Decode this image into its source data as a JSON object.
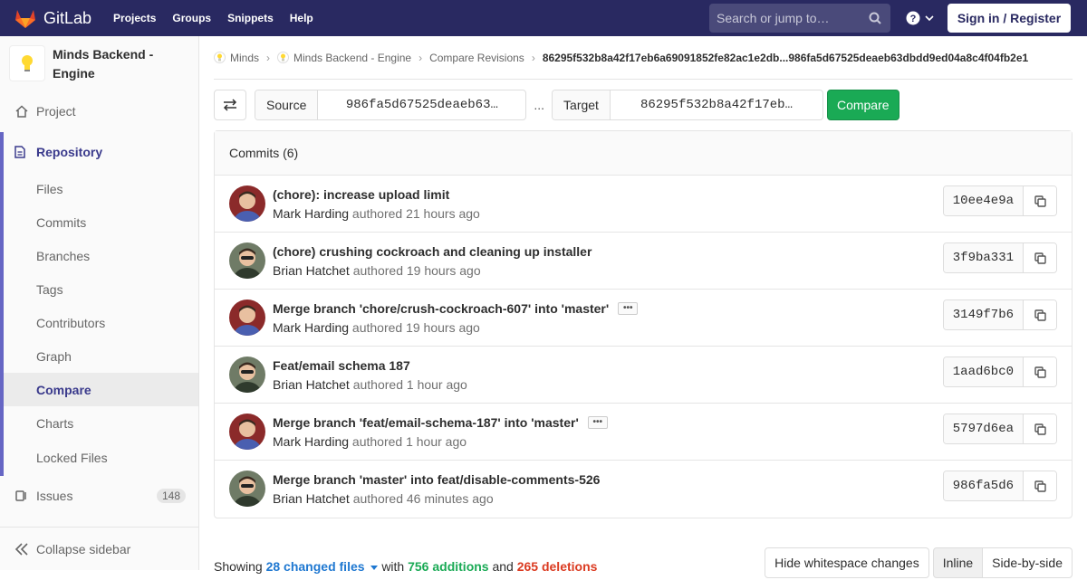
{
  "navbar": {
    "brand": "GitLab",
    "links": [
      "Projects",
      "Groups",
      "Snippets",
      "Help"
    ],
    "search_placeholder": "Search or jump to…",
    "signin": "Sign in / Register"
  },
  "sidebar": {
    "project_name_line1": "Minds Backend -",
    "project_name_line2": "Engine",
    "project": "Project",
    "repository": "Repository",
    "repo_items": [
      "Files",
      "Commits",
      "Branches",
      "Tags",
      "Contributors",
      "Graph",
      "Compare",
      "Charts",
      "Locked Files"
    ],
    "active_item": "Compare",
    "issues": "Issues",
    "issues_count": "148",
    "collapse": "Collapse sidebar"
  },
  "breadcrumb": {
    "items": [
      "Minds",
      "Minds Backend - Engine",
      "Compare Revisions"
    ],
    "current": "86295f532b8a42f17eb6a69091852fe82ac1e2db...986fa5d67525deaeb63dbdd9ed04a8c4f04fb2e1"
  },
  "compare": {
    "source_label": "Source",
    "source_value": "986fa5d67525deaeb63…",
    "dots": "...",
    "target_label": "Target",
    "target_value": "86295f532b8a42f17eb…",
    "button": "Compare"
  },
  "commits": {
    "header": "Commits (6)",
    "authored": "authored",
    "list": [
      {
        "title": "(chore): increase upload limit",
        "author": "Mark Harding",
        "time": "21 hours ago",
        "sha": "10ee4e9a",
        "expand": false
      },
      {
        "title": "(chore) crushing cockroach and cleaning up installer",
        "author": "Brian Hatchet",
        "time": "19 hours ago",
        "sha": "3f9ba331",
        "expand": false
      },
      {
        "title": "Merge branch 'chore/crush-cockroach-607' into 'master'",
        "author": "Mark Harding",
        "time": "19 hours ago",
        "sha": "3149f7b6",
        "expand": true
      },
      {
        "title": "Feat/email schema 187",
        "author": "Brian Hatchet",
        "time": "1 hour ago",
        "sha": "1aad6bc0",
        "expand": false
      },
      {
        "title": "Merge branch 'feat/email-schema-187' into 'master'",
        "author": "Mark Harding",
        "time": "1 hour ago",
        "sha": "5797d6ea",
        "expand": true
      },
      {
        "title": "Merge branch 'master' into feat/disable-comments-526",
        "author": "Brian Hatchet",
        "time": "46 minutes ago",
        "sha": "986fa5d6",
        "expand": false
      }
    ]
  },
  "summary": {
    "showing": "Showing",
    "changed_files": "28 changed files",
    "with": "with",
    "additions": "756 additions",
    "and": "and",
    "deletions": "265 deletions",
    "hide_whitespace": "Hide whitespace changes",
    "inline": "Inline",
    "side_by_side": "Side-by-side"
  },
  "colors": {
    "navbar": "#292961",
    "accent": "#6666c4",
    "compare_green": "#1aaa55",
    "link_blue": "#1f78d1",
    "deletion_red": "#db3b21"
  }
}
